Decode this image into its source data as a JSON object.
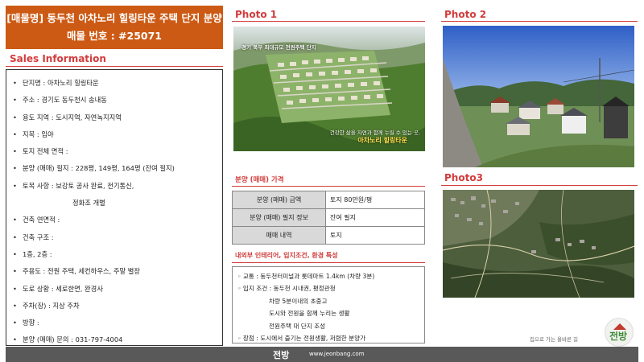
{
  "header": {
    "title": "[매물명] 동두천 아차노리 힐링타운 주택 단지 분양",
    "number": "매물 번호 : #25071"
  },
  "sales": {
    "title": "Sales Information",
    "items": [
      "단지명 : 아차노리 힐링타운",
      "주소 : 경기도 동두천시 송내동",
      "용도 지역 : 도시지역, 자연녹지지역",
      "지목 : 임야",
      "토지 전체 면적 :",
      "분양 (매매) 필지 : 228평, 149평, 164평 (잔여 필지)",
      "토목 사항 : 보강토 공사 완료, 전기통신,",
      "정화조 개별",
      "건축 연면적 :",
      "건축 구조 :",
      "1층, 2층 :",
      "주용도 : 전원 주택, 세컨하우스, 주말 별장",
      "도로 상황 : 세로한면, 완경사",
      "주차(장) : 지상 주차",
      "방향 :",
      "분양 (매매) 문의 : 031-797-4004"
    ]
  },
  "photo1": {
    "title": "Photo 1",
    "caption_top": "경기 북부 최대규모 전원주택 단지",
    "caption_sub": "건강한 삶을 자연과 함께 누릴 수 있는 곳,",
    "caption_name": "아차노리 힐링타운"
  },
  "photo2": {
    "title": "Photo 2"
  },
  "photo3": {
    "title": "Photo3"
  },
  "price": {
    "title": "분양 (매매) 가격",
    "rows": [
      {
        "k": "분양 (매매) 금액",
        "v": "토지 80만원/평"
      },
      {
        "k": "분양 (매매) 필지 정보",
        "v": "잔여 필지"
      },
      {
        "k": "매매 내역",
        "v": "토지"
      }
    ]
  },
  "features": {
    "title": "내외부 인테리어, 입지조건, 환경 특성",
    "lines": [
      "◦ 교통 : 동두천터미널과 롯데마트 1.4km (차량 3분)",
      "◦ 입지 조건 : 동두천 시내권, 평정관청",
      "차량 5분이내의 초중고",
      "도시와 전원을 함께 누리는 생활",
      "전원주택 대 단지 조성",
      "◦ 장점 : 도시에서 즐기는 전원생활, 저렴한 분양가"
    ]
  },
  "logo": {
    "slogan": "집으로 가는 올바른 길",
    "text": "전방"
  },
  "footer": {
    "brand": "전방",
    "url": "www.jeonbang.com"
  },
  "colors": {
    "header_bg": "#cc5a14",
    "accent_red": "#d23c3c",
    "footer_bg": "#595959",
    "logo_green": "#3f8d3a"
  }
}
